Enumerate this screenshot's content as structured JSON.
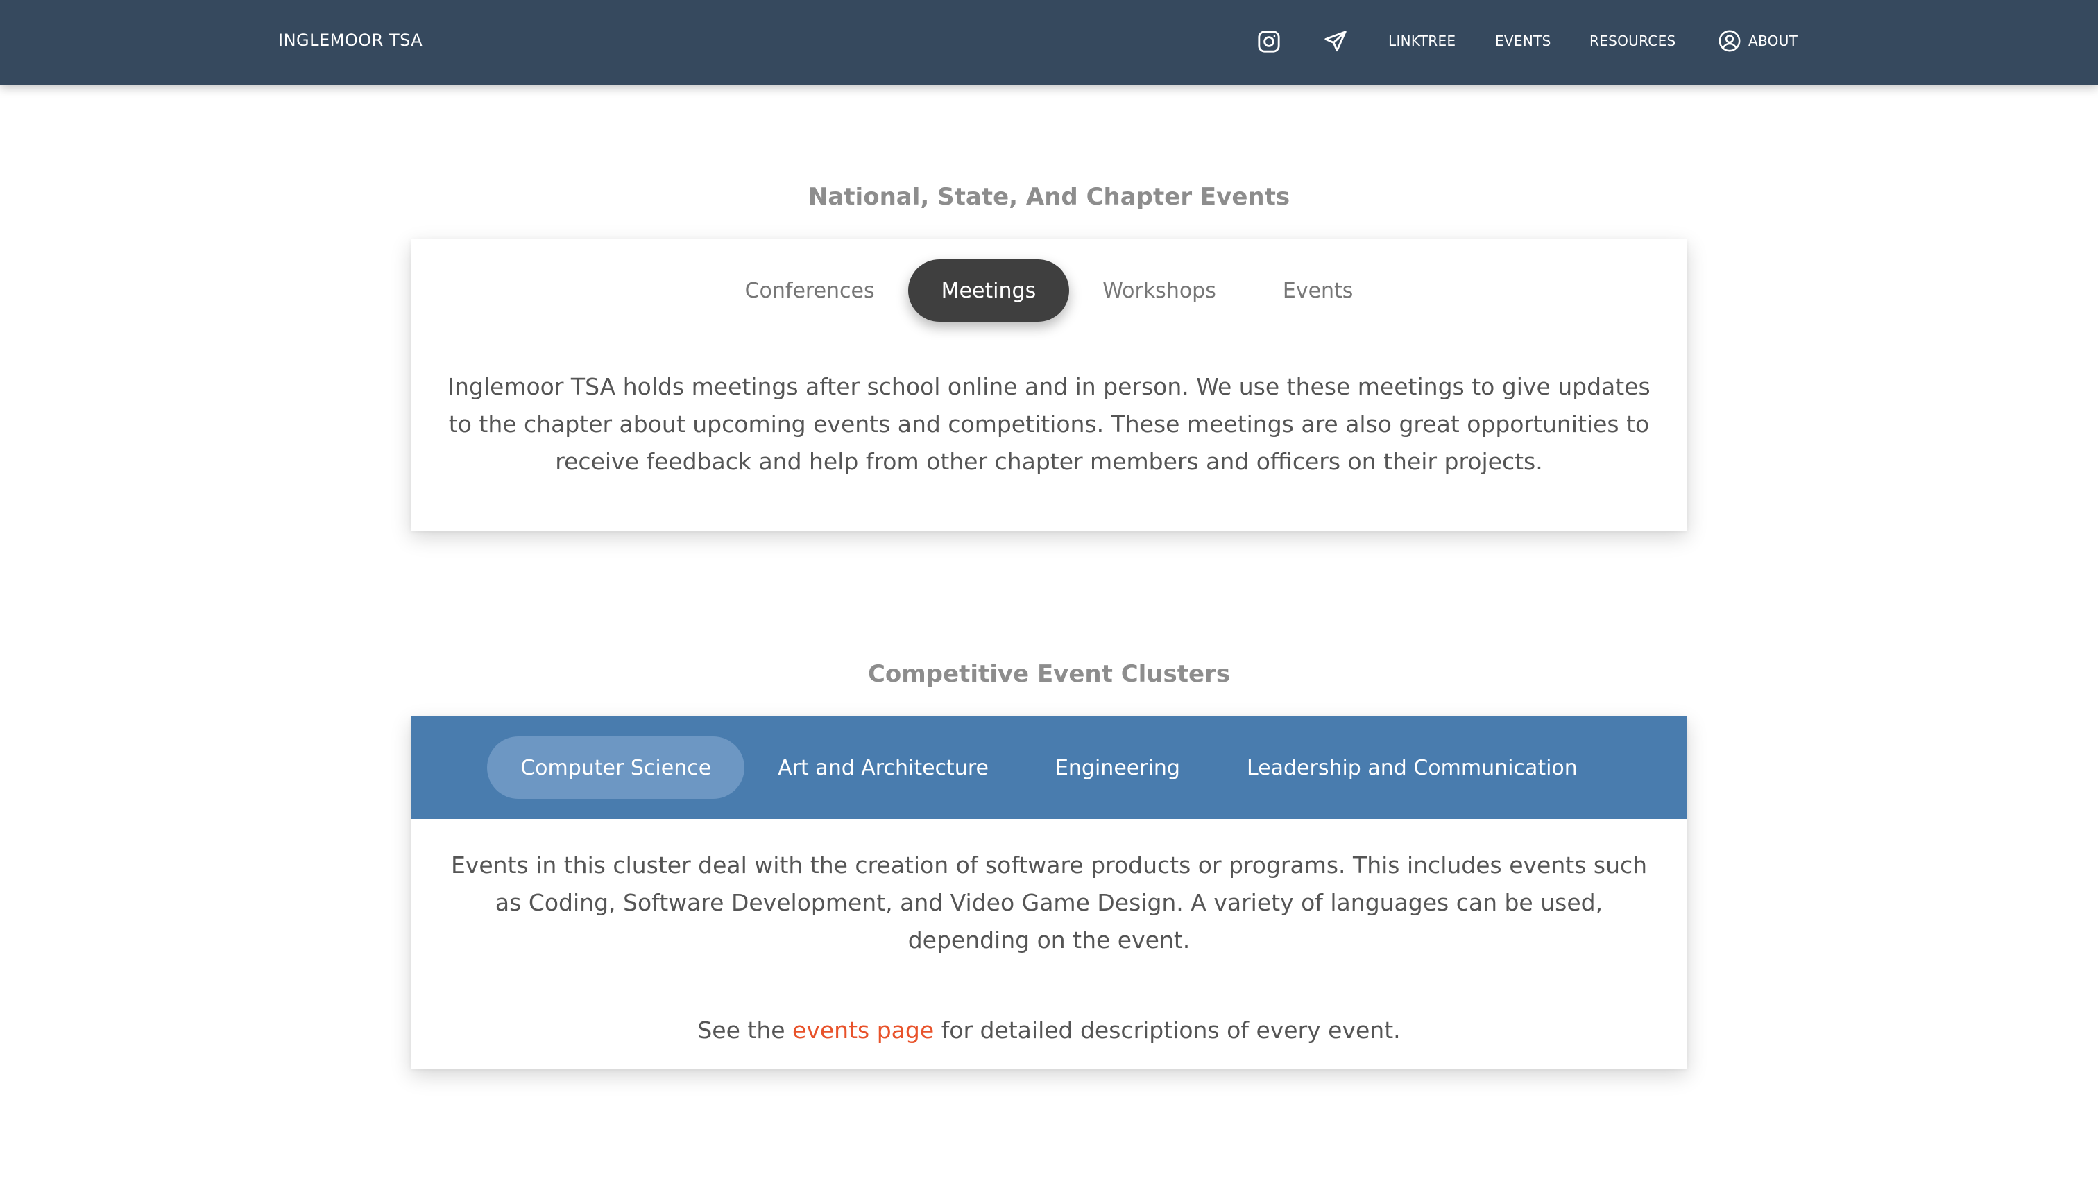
{
  "navbar": {
    "brand": "INGLEMOOR TSA",
    "icons": [
      "instagram-icon",
      "paper-plane-icon",
      "user-circle-icon"
    ],
    "links": {
      "linktree": "LINKTREE",
      "events": "EVENTS",
      "resources": "RESOURCES",
      "about": "ABOUT"
    },
    "colors": {
      "background": "#36495e",
      "text": "#ffffff"
    }
  },
  "events_section": {
    "title": "National, State, And Chapter Events",
    "tabs": [
      "Conferences",
      "Meetings",
      "Workshops",
      "Events"
    ],
    "active_tab": "Meetings",
    "content": "Inglemoor TSA holds meetings after school online and in person. We use these meetings to give updates to the chapter about upcoming events and competitions. These meetings are also great opportunities to receive feedback and help from other chapter members and officers on their projects.",
    "colors": {
      "active_tab_bg": "#3f3f3f",
      "active_tab_text": "#ffffff",
      "tab_text": "#777777"
    }
  },
  "clusters_section": {
    "title": "Competitive Event Clusters",
    "tabs": [
      "Computer Science",
      "Art and Architecture",
      "Engineering",
      "Leadership and Communication"
    ],
    "active_tab": "Computer Science",
    "content": "Events in this cluster deal with the creation of software products or programs. This includes events such as Coding, Software Development, and Video Game Design. A variety of languages can be used, depending on the event.",
    "footer": {
      "prefix": "See the ",
      "link_text": "events page",
      "suffix": " for detailed descriptions of every event."
    },
    "colors": {
      "bar_bg": "#497cae",
      "active_tab_bg": "#6d97c3",
      "link": "#e8522a"
    }
  }
}
